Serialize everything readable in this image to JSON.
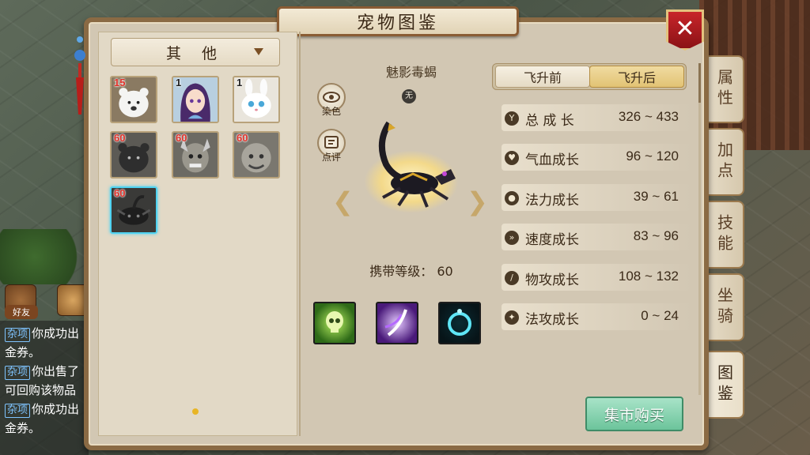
{
  "window": {
    "title": "宠物图鉴",
    "close_symbol": "✕"
  },
  "chat": {
    "friends_label": "好友",
    "lines": [
      {
        "tag": "杂项",
        "text": "你成功出"
      },
      {
        "tag": "",
        "text": "金券。"
      },
      {
        "tag": "杂项",
        "text": "你出售了"
      },
      {
        "tag": "",
        "text": "可回购该物品"
      },
      {
        "tag": "杂项",
        "text": "你成功出"
      },
      {
        "tag": "",
        "text": "金券。"
      }
    ]
  },
  "side_tabs": [
    "属性",
    "加点",
    "技能",
    "坐骑",
    "图鉴"
  ],
  "active_side_tab": "图鉴",
  "list": {
    "category": "其 他",
    "pets": [
      {
        "level": "15",
        "kind": "white-bear"
      },
      {
        "level": "1",
        "kind": "purple-hair-girl"
      },
      {
        "level": "1",
        "kind": "white-rabbit"
      },
      {
        "level": "60",
        "kind": "black-bear"
      },
      {
        "level": "60",
        "kind": "gray-demon"
      },
      {
        "level": "60",
        "kind": "gray-beast"
      },
      {
        "level": "60",
        "kind": "dark-scorpion"
      }
    ],
    "selected_index": 6
  },
  "detail": {
    "pet_name": "魅影毒蝎",
    "element": "无",
    "dye_label": "染色",
    "review_label": "点评",
    "carry_level_label": "携带等级：",
    "carry_level": "60",
    "skills": [
      "green-skull-skill",
      "purple-blade-skill",
      "cyan-ring-skill"
    ]
  },
  "stats": {
    "toggle": {
      "before": "飞升前",
      "after": "飞升后",
      "active": "after"
    },
    "rows": [
      {
        "label": "总 成 长",
        "value": "326 ~ 433",
        "icon": "Y"
      },
      {
        "label": "气血成长",
        "value": "96 ~ 120",
        "icon": "♥"
      },
      {
        "label": "法力成长",
        "value": "39 ~ 61",
        "icon": "●"
      },
      {
        "label": "速度成长",
        "value": "83 ~ 96",
        "icon": "»"
      },
      {
        "label": "物攻成长",
        "value": "108 ~ 132",
        "icon": "/"
      },
      {
        "label": "法攻成长",
        "value": "0 ~ 24",
        "icon": "✦"
      }
    ]
  },
  "buy_button": "集市购买",
  "colors": {
    "panel_bg": "#d2c7b3",
    "frame": "#8a6a44",
    "close_red": "#c8252a",
    "buy_green": "#6cc49b",
    "level_red": "#e0322a",
    "select_cyan": "#4fd3f2"
  }
}
